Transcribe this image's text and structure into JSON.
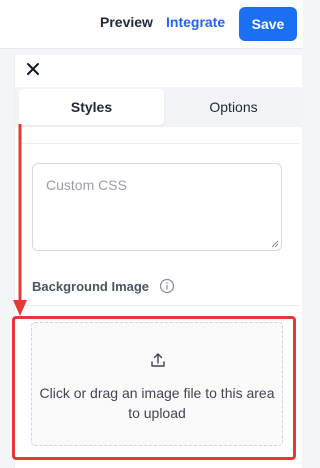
{
  "topbar": {
    "preview_label": "Preview",
    "integrate_label": "Integrate",
    "save_label": "Save"
  },
  "panel": {
    "tabs": [
      {
        "label": "Styles",
        "active": true
      },
      {
        "label": "Options",
        "active": false
      }
    ],
    "custom_css": {
      "placeholder": "Custom CSS",
      "value": ""
    },
    "background_image": {
      "label": "Background Image",
      "upload_text": "Click or drag an image file to this area to upload"
    }
  },
  "colors": {
    "accent": "#1d6ff2",
    "annotation": "#e53935"
  },
  "icons": [
    "close-icon",
    "info-icon",
    "upload-icon"
  ]
}
